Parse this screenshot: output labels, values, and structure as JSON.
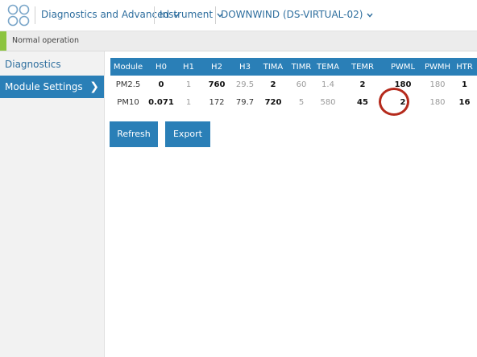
{
  "topbar": {
    "menus": [
      {
        "label": "Diagnostics and Advanced"
      },
      {
        "label": "Instrument"
      },
      {
        "label": "DOWNWIND (DS-VIRTUAL-02)"
      }
    ]
  },
  "status": {
    "text": "Normal operation",
    "accent_color": "#8cc43f"
  },
  "sidebar": {
    "items": [
      {
        "label": "Diagnostics"
      },
      {
        "label": "Module Settings",
        "active": true
      }
    ]
  },
  "table": {
    "headers": [
      "Module",
      "H0",
      "H1",
      "H2",
      "H3",
      "TIMA",
      "TIMR",
      "TEMA",
      "TEMR",
      "PWML",
      "PWMH",
      "HTR"
    ],
    "rows": [
      [
        "PM2.5",
        "0",
        "1",
        "760",
        "29.5",
        "2",
        "60",
        "1.4",
        "2",
        "180",
        "180",
        "1"
      ],
      [
        "PM10",
        "0.071",
        "1",
        "172",
        "79.7",
        "720",
        "5",
        "580",
        "45",
        "2",
        "180",
        "16"
      ]
    ],
    "highlighted_cell": {
      "row": 1,
      "col": "PWML"
    }
  },
  "buttons": {
    "refresh": "Refresh",
    "export": "Export"
  },
  "colors": {
    "primary": "#2a7fb7",
    "highlight_circle": "#b52a1c"
  }
}
